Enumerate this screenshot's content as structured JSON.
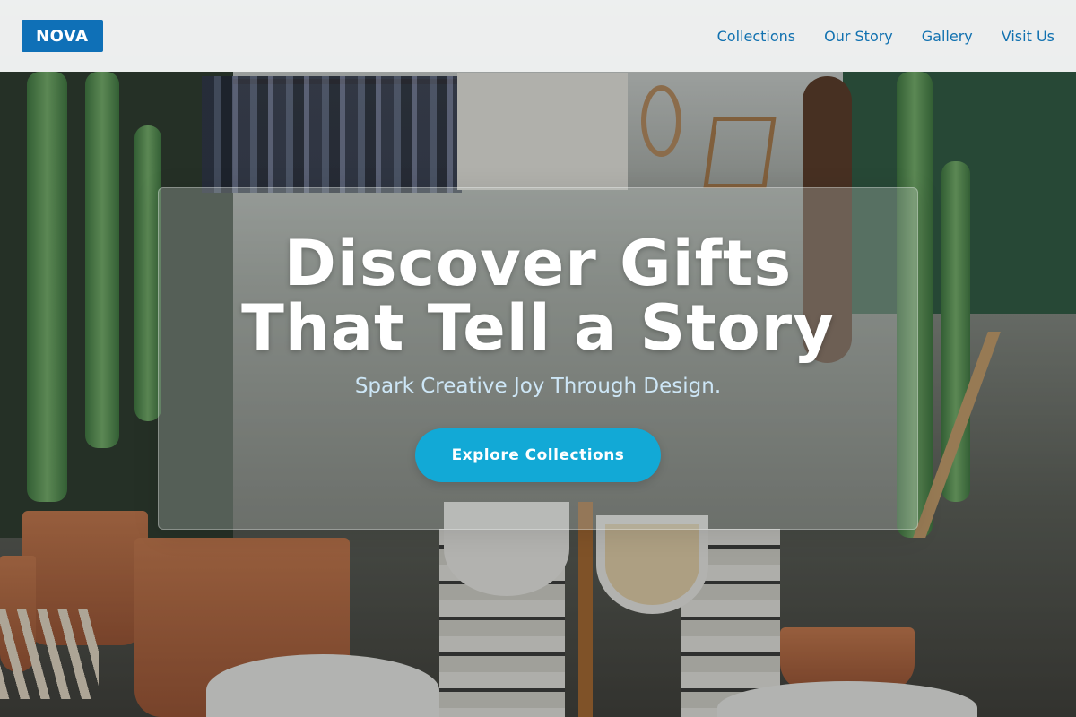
{
  "header": {
    "logo": "NOVA",
    "nav": [
      {
        "label": "Collections"
      },
      {
        "label": "Our Story"
      },
      {
        "label": "Gallery"
      },
      {
        "label": "Visit Us"
      }
    ]
  },
  "hero": {
    "title_line1": "Discover Gifts",
    "title_line2": "That Tell a Story",
    "subtitle": "Spark Creative Joy Through Design.",
    "cta_label": "Explore Collections"
  },
  "colors": {
    "logo_bg": "#0f70b7",
    "nav_link": "#1171b0",
    "cta_bg": "#12a9d6",
    "subtitle": "#cde6f6"
  },
  "icons": []
}
